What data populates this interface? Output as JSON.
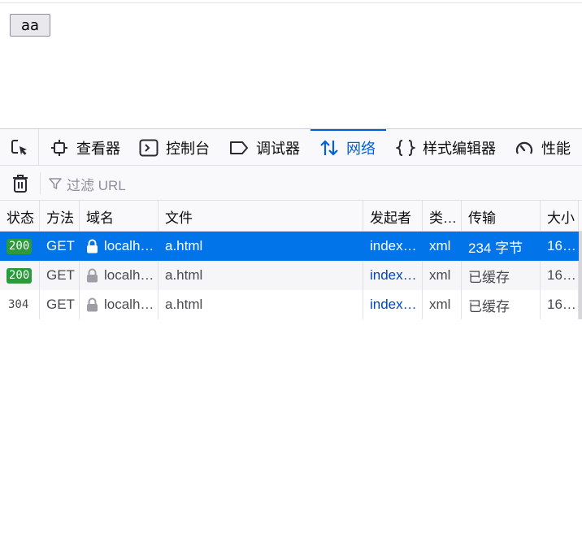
{
  "page": {
    "button_label": "aa"
  },
  "devtools": {
    "tabs": [
      {
        "label": "查看器",
        "icon": "inspector-icon"
      },
      {
        "label": "控制台",
        "icon": "console-icon"
      },
      {
        "label": "调试器",
        "icon": "debugger-icon"
      },
      {
        "label": "网络",
        "icon": "network-icon",
        "active": true
      },
      {
        "label": "样式编辑器",
        "icon": "style-editor-icon"
      },
      {
        "label": "性能",
        "icon": "performance-icon"
      }
    ],
    "filter_placeholder": "过滤 URL",
    "columns": [
      "状态",
      "方法",
      "域名",
      "文件",
      "发起者",
      "类…",
      "传输",
      "大小"
    ],
    "requests": [
      {
        "status": "200",
        "method": "GET",
        "domain": "localh…",
        "file": "a.html",
        "initiator": "index…",
        "type": "xml",
        "transferred": "234 字节",
        "size": "16…"
      },
      {
        "status": "200",
        "method": "GET",
        "domain": "localh…",
        "file": "a.html",
        "initiator": "index…",
        "type": "xml",
        "transferred": "已缓存",
        "size": "16…"
      },
      {
        "status": "304",
        "method": "GET",
        "domain": "localh…",
        "file": "a.html",
        "initiator": "index…",
        "type": "xml",
        "transferred": "已缓存",
        "size": "16…"
      }
    ],
    "colors": {
      "accent": "#0060df",
      "selected_row": "#0074e8",
      "status_ok": "#2a9a3a",
      "initiator_link": "#0046b8"
    }
  }
}
